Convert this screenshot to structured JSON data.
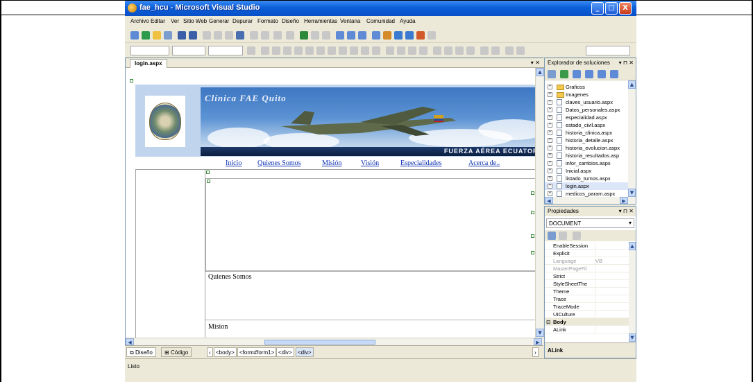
{
  "window": {
    "title": "fae_hcu - Microsoft Visual Studio",
    "minimize": "_",
    "maximize": "□",
    "close": "X"
  },
  "menu": [
    "Archivo",
    "Editar",
    "Ver",
    "Sitio Web",
    "Generar",
    "Depurar",
    "Formato",
    "Diseño",
    "Herramientas",
    "Ventana",
    "Comunidad",
    "Ayuda"
  ],
  "document": {
    "tab": "login.aspx",
    "tab_controls": "▾ ✕",
    "banner_title": "Clínica FAE Quito",
    "banner_footer": "FUERZA AÉREA ECUATORI",
    "nav": [
      "Inicio",
      "Quienes Somos",
      "Misión",
      "Visión",
      "Especialidades",
      "Acerca de.."
    ],
    "section_quienes": "Quienes Somos",
    "section_mision": "Mision"
  },
  "bottom": {
    "tab_design": "Diseño",
    "tab_code": "Código",
    "crumbs": [
      "<body>",
      "<form#form1>",
      "<div>",
      "<div>"
    ]
  },
  "status": "Listo",
  "solution_explorer": {
    "title": "Explorador de soluciones",
    "controls": "▾ ⊓ ✕",
    "items": [
      {
        "label": "Graficos",
        "type": "folder"
      },
      {
        "label": "Imagenes",
        "type": "folder"
      },
      {
        "label": "claves_usuario.aspx",
        "type": "file"
      },
      {
        "label": "Datos_personales.aspx",
        "type": "file"
      },
      {
        "label": "especialidad.aspx",
        "type": "file"
      },
      {
        "label": "estado_civil.aspx",
        "type": "file"
      },
      {
        "label": "historia_clinica.aspx",
        "type": "file"
      },
      {
        "label": "historia_detalle.aspx",
        "type": "file"
      },
      {
        "label": "historia_evolucion.aspx",
        "type": "file"
      },
      {
        "label": "historia_resultados.asp",
        "type": "file"
      },
      {
        "label": "infor_cambios.aspx",
        "type": "file"
      },
      {
        "label": "Inicial.aspx",
        "type": "file"
      },
      {
        "label": "listado_turnos.aspx",
        "type": "file"
      },
      {
        "label": "login.aspx",
        "type": "file"
      },
      {
        "label": "medicos_param.aspx",
        "type": "file"
      }
    ]
  },
  "properties": {
    "title": "Propiedades",
    "controls": "▾ ⊓ ✕",
    "object": "DOCUMENT",
    "rows": [
      {
        "name": "EnableSession",
        "value": ""
      },
      {
        "name": "Explicit",
        "value": ""
      },
      {
        "name": "Language",
        "value": "VB"
      },
      {
        "name": "MasterPageFil",
        "value": ""
      },
      {
        "name": "Strict",
        "value": ""
      },
      {
        "name": "StyleSheetThe",
        "value": ""
      },
      {
        "name": "Theme",
        "value": ""
      },
      {
        "name": "Trace",
        "value": ""
      },
      {
        "name": "TraceMode",
        "value": ""
      },
      {
        "name": "UICulture",
        "value": ""
      },
      {
        "name": "Body",
        "value": ""
      },
      {
        "name": "ALink",
        "value": ""
      }
    ],
    "description_title": "ALink"
  }
}
